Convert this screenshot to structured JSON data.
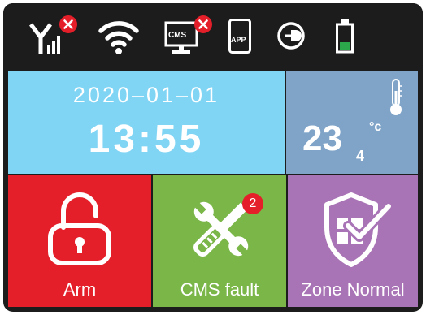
{
  "status_bar": {
    "icons": [
      {
        "name": "cellular-signal-icon",
        "state": "disconnected"
      },
      {
        "name": "wifi-icon",
        "state": "connected"
      },
      {
        "name": "cms-monitor-icon",
        "label": "CMS",
        "state": "disconnected"
      },
      {
        "name": "app-icon",
        "label": "APP"
      },
      {
        "name": "ac-power-icon"
      },
      {
        "name": "battery-icon",
        "level": "low"
      }
    ],
    "cms_icon_label": "CMS",
    "app_icon_label": "APP"
  },
  "clock": {
    "date": "2020–01–01",
    "time": "13:55"
  },
  "temperature": {
    "value": "23",
    "decimal": "4",
    "unit": "°c"
  },
  "tiles": {
    "arm": {
      "label": "Arm",
      "color": "#e51f2a"
    },
    "cms": {
      "label": "CMS fault",
      "badge": "2",
      "color": "#7ab648"
    },
    "zone": {
      "label": "Zone Normal",
      "color": "#a974b5"
    }
  },
  "colors": {
    "status_bar": "#1c1c1c",
    "date_tile": "#80d4f4",
    "temp_tile": "#7fa4c8",
    "error_badge": "#e51f2a",
    "battery_fill": "#2ca64a"
  }
}
